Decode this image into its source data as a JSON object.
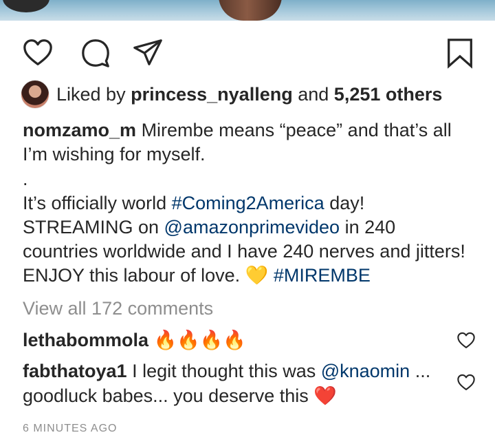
{
  "post": {
    "likes": {
      "prefix": "Liked by",
      "liker": "princess_nyalleng",
      "joiner": "and",
      "others": "5,251 others"
    },
    "caption": {
      "username": "nomzamo_m",
      "line1_text": "Mirembe means “peace” and that’s all I’m wishing for myself.",
      "dot": ".",
      "p2_a": "It’s officially world ",
      "hashtag1": "#Coming2America",
      "p2_b": " day! STREAMING on ",
      "mention1": "@amazonprimevideo",
      "p2_c": " in 240 countries worldwide and I have 240 nerves and jitters! ENJOY this labour of love. ",
      "emoji_heart_yellow": "💛",
      "hashtag2": "#MIREMBE"
    },
    "view_all_comments": "View all 172 comments",
    "comments": [
      {
        "username": "lethabommola",
        "text": "🔥🔥🔥🔥"
      },
      {
        "username": "fabthatoya1",
        "text_a": "I legit thought this was ",
        "mention": "@knaomin",
        "text_b": " ... goodluck babes... you deserve this ",
        "emoji": "❤️"
      }
    ],
    "timestamp": "6 MINUTES AGO"
  },
  "icons": {
    "like": "heart-outline-icon",
    "comment": "comment-bubble-icon",
    "share": "paper-plane-icon",
    "save": "bookmark-icon"
  },
  "colors": {
    "text": "#262626",
    "muted": "#8e8e8e",
    "link": "#00376b",
    "fire": "#f59e0b",
    "heart_red": "#e0245e",
    "heart_yellow": "#f5c518"
  }
}
